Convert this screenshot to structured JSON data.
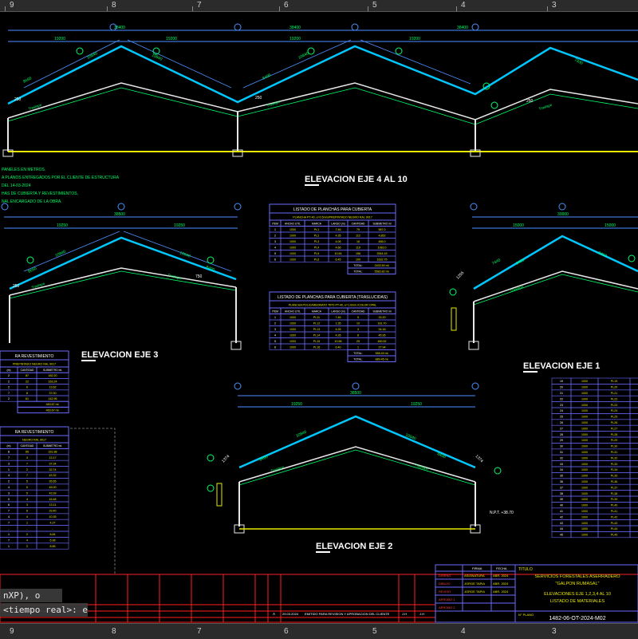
{
  "rulers": {
    "top": [
      "9",
      "8",
      "7",
      "6",
      "5",
      "4",
      "3"
    ],
    "bottom": [
      "9",
      "8",
      "7",
      "6",
      "5",
      "4",
      "3"
    ]
  },
  "command_line": {
    "line1": "nXP), o",
    "line2": "<tiempo real>: e"
  },
  "views": {
    "eje_4_10": {
      "title": "ELEVACION EJE 4 AL 10",
      "overall": "38400",
      "spans": [
        "19200",
        "19200",
        "19200",
        "19200"
      ],
      "slopes": [
        "10840",
        "10840",
        "10840"
      ],
      "rises": [
        "8650",
        "8400",
        "7930"
      ],
      "eaves": [
        "250",
        "250",
        "250"
      ],
      "label_traslape": "Traslape"
    },
    "eje_3": {
      "title": "ELEVACION EJE 3",
      "overall": "38500",
      "spans": [
        "19250",
        "19250"
      ],
      "slopes": [
        "10840",
        "10840"
      ],
      "rises": [
        "8650",
        "8400"
      ],
      "eaves": [
        "250",
        "750"
      ],
      "label_traslape": "Traslape"
    },
    "eje_1": {
      "title": "ELEVACION EJE 1",
      "overall": "30000",
      "spans": [
        "15000",
        "15000"
      ],
      "slopes": [
        "8450",
        "8450"
      ],
      "rises": [
        "7440",
        "7440"
      ],
      "eaves": [
        "1255",
        "1255"
      ],
      "label_traslape": "Traslape"
    },
    "eje_2": {
      "title": "ELEVACION EJE 2",
      "overall": "38500",
      "spans": [
        "19250",
        "19250"
      ],
      "slopes": [
        "10840",
        "10840"
      ],
      "rises": [
        "8400",
        "8400"
      ],
      "eaves": [
        "1374",
        "1374"
      ],
      "npt": "N.P.T. +38.70",
      "label_traslape": "Traslape"
    }
  },
  "notes": [
    "PANELES EN METROS.",
    "A PLANOS ENTREGADOS POR EL CLIENTE DE ESTRUCTURA",
    "DEL 14-03-2024",
    "HAS DE CUBIERTA Y REVESTIMIENTOS,",
    "NAL ENCARGADO DE LA OBRA."
  ],
  "table_cubierta": {
    "title": "LISTADO DE PLANCHAS PARA CUBIERTA",
    "subtitle": "PLANCHA PT-40, e=0.5mm/PREPINTADO NEGRO RAL 9017",
    "headers": [
      "ITEM",
      "ANCHO UTIL",
      "MARCA",
      "LARGO (m)",
      "CANTIDAD",
      "SUBMETRO ml"
    ],
    "rows": [
      [
        "1",
        "1000",
        "PL1",
        "7.46",
        "79",
        "587.0"
      ],
      [
        "2",
        "1000",
        "PL2",
        "4.35",
        "112",
        "4,852"
      ],
      [
        "3",
        "1000",
        "PL3",
        "4.06",
        "16",
        "466.0"
      ],
      [
        "4",
        "1000",
        "PL4",
        "4.66",
        "119",
        "1083.0"
      ],
      [
        "5",
        "1000",
        "PL5",
        "10.54",
        "156",
        "2544.15"
      ],
      [
        "6",
        "1000",
        "PL6",
        "6.45",
        "100",
        "1632.75"
      ]
    ],
    "total_label": "TOTAL:",
    "totals": [
      "2433.50 ml.",
      "5583.82 ml."
    ]
  },
  "table_traslucida": {
    "title": "LISTADO DE PLANCHAS PARA CUBIERTA (TRASLUCIDAS)",
    "subtitle": "PLANCHA POLICARBONATO TIPO PT-40, e=1.0mm./COLOR OPAL",
    "headers": [
      "ITEM",
      "ANCHO UTIL",
      "MARCA",
      "LARGO (m)",
      "CANTIDAD",
      "SUBMETRO ml"
    ],
    "rows": [
      [
        "1",
        "1000",
        "PL11",
        "7.46",
        "5",
        "33.20"
      ],
      [
        "2",
        "1000",
        "PL12",
        "1.35",
        "10",
        "181.70"
      ],
      [
        "3",
        "1000",
        "PL13",
        "4.26",
        "3",
        "34.18"
      ],
      [
        "4",
        "1000",
        "PL14",
        "4.26",
        "8",
        "45.95"
      ],
      [
        "5",
        "1000",
        "PL15",
        "10.56",
        "25",
        "460.52"
      ],
      [
        "6",
        "1000",
        "PL16",
        "6.40",
        "1",
        "27.94"
      ]
    ],
    "total_label": "TOTAL:",
    "totals": [
      "558.49 ml.",
      "889.45 ml."
    ]
  },
  "table_revestimiento_1": {
    "title": "RA REVESTIMIENTO",
    "subtitle": "PREPINTADO NEGRO RAL 9017",
    "headers": [
      "(m)",
      "CANTIDAD",
      "SUBMETRO ml."
    ],
    "rows": [
      [
        "2",
        "87",
        "182.20"
      ],
      [
        "2",
        "22",
        "163.24"
      ],
      [
        "2",
        "6",
        "13.62"
      ],
      [
        "7",
        "8",
        "37.00"
      ],
      [
        "2",
        "61",
        "142.96"
      ]
    ],
    "totals": [
      "463.67 ml.",
      "463.67 ml."
    ]
  },
  "table_revestimiento_2": {
    "title": "RA REVESTIMIENTO",
    "subtitle": "NEGRO RAL 9017",
    "headers": [
      "(m)",
      "CANTIDAD",
      "SUBMETRO ml."
    ],
    "rows": [
      [
        "8",
        "65",
        "331.88"
      ],
      [
        "7",
        "3",
        "13.17"
      ],
      [
        "3",
        "7",
        "37.34"
      ],
      [
        "1",
        "2",
        "32.74"
      ],
      [
        "4",
        "7",
        "43.32"
      ],
      [
        "2",
        "5",
        "35.65"
      ],
      [
        "4",
        "5",
        "45.00"
      ],
      [
        "3",
        "5",
        "43.39"
      ],
      [
        "0",
        "4",
        "16.48"
      ],
      [
        "6",
        "3",
        "13.11"
      ],
      [
        "7",
        "6",
        "29.40"
      ],
      [
        "4",
        "4",
        "10.35"
      ],
      [
        "7",
        "1",
        "4.27"
      ],
      [
        "-",
        "-",
        "-"
      ],
      [
        "1",
        "2",
        "8.84"
      ],
      [
        "7",
        "4",
        "6.98"
      ],
      [
        "1",
        "2",
        "8.85"
      ]
    ]
  },
  "table_right": {
    "rows": [
      [
        "19",
        "1000",
        "PL19",
        "1.41"
      ],
      [
        "20",
        "1000",
        "PL20",
        "3.36"
      ],
      [
        "21",
        "1000",
        "PL21",
        "4.06"
      ],
      [
        "22",
        "1000",
        "PL22",
        "4.56"
      ],
      [
        "23",
        "1000",
        "PL23",
        "4.85"
      ],
      [
        "24",
        "1000",
        "PL24",
        "3.16"
      ],
      [
        "25",
        "1000",
        "PL25",
        "5.45"
      ],
      [
        "26",
        "1000",
        "PL26",
        "5.14"
      ],
      [
        "27",
        "1000",
        "PL27",
        "5.08"
      ],
      [
        "28",
        "1000",
        "PL28",
        "5.65"
      ],
      [
        "29",
        "1000",
        "PL29",
        "2.60"
      ],
      [
        "30",
        "1000",
        "PL30",
        "3.13"
      ],
      [
        "31",
        "1000",
        "PL31",
        "5.54"
      ],
      [
        "32",
        "1000",
        "PL32",
        "4.05"
      ],
      [
        "33",
        "1000",
        "PL33",
        "3.00"
      ],
      [
        "34",
        "1000",
        "PL34",
        "2.54"
      ],
      [
        "35",
        "1000",
        "PL35",
        "4.45"
      ],
      [
        "36",
        "1000",
        "PL36",
        "2.30"
      ],
      [
        "37",
        "1000",
        "PL37",
        "2.05"
      ],
      [
        "38",
        "1000",
        "PL38",
        "1.85"
      ],
      [
        "39",
        "1000",
        "PL39",
        "1.30"
      ],
      [
        "40",
        "1000",
        "PL40",
        "1.34"
      ],
      [
        "41",
        "1000",
        "PL41",
        "1.50"
      ],
      [
        "42",
        "1000",
        "PL42",
        "1.59"
      ],
      [
        "43",
        "1000",
        "PL43",
        "1.33"
      ],
      [
        "44",
        "1000",
        "PL44",
        "1.30"
      ],
      [
        "45",
        "1000",
        "PL45",
        "1.09"
      ]
    ]
  },
  "title_block": {
    "header_titulo": "TITULO",
    "col_firma": "FIRMA",
    "col_fecha": "FECHA",
    "roles": [
      "DISEÑO",
      "DIBUJO",
      "REVISO",
      "APROBO 1",
      "APROBO 2"
    ],
    "names": [
      "ASIGNATURA",
      "JORGE TAPIA",
      "JORGE TAPIA"
    ],
    "dates": [
      "ABR. 2024",
      "ABR. 2024",
      "ABR. 2024"
    ],
    "project": "SERVICIOS FORESTALES ASERRADERO",
    "project2": "\"GALPON RUMASAL\"",
    "drawing": "ELEVACIONES EJE 1,2,3,4 AL 10",
    "drawing2": "LISTADO DE MATERIALES",
    "plan_label": "N° PLANO",
    "plan_number": "1482-06-OT-2024-M02",
    "rev_letter": "A",
    "rev_date": "29.03.2024",
    "rev_desc": "EMITIDO PARA REVISION Y APROBACION DEL CLIENTE",
    "rev_by1": "J.H",
    "rev_by2": "J.H"
  },
  "colors": {
    "background": "#000000",
    "roof": "#00c8ff",
    "structure": "#e8e8e8",
    "floor": "#e8e800",
    "dimension": "#4a90ff",
    "annotation": "#00ff66",
    "label": "#ffffff",
    "table": "#6a6aff",
    "frame": "#ff2020"
  }
}
